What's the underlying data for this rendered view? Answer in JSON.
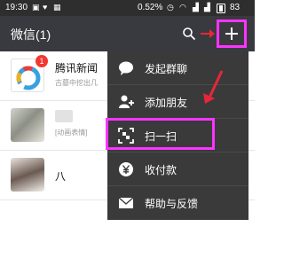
{
  "status_bar": {
    "time": "19:30",
    "battery_percent": "0.52%",
    "battery_level": "83"
  },
  "header": {
    "title": "微信(1)"
  },
  "chats": [
    {
      "name": "腾讯新闻",
      "preview": "古墓中挖出几",
      "badge": "1",
      "avatar": "news-logo"
    },
    {
      "name": "",
      "preview": "[动画表情]",
      "avatar": "photo"
    },
    {
      "name": "八",
      "preview": "",
      "avatar": "photo"
    }
  ],
  "menu": {
    "items": [
      {
        "label": "发起群聊",
        "icon": "chat-bubble-icon"
      },
      {
        "label": "添加朋友",
        "icon": "add-friend-icon"
      },
      {
        "label": "扫一扫",
        "icon": "scan-icon"
      },
      {
        "label": "收付款",
        "icon": "yen-icon"
      },
      {
        "label": "帮助与反馈",
        "icon": "mail-icon"
      }
    ]
  },
  "colors": {
    "header_bg": "#393a3f",
    "status_bg": "#2e2e2e",
    "menu_bg": "#3a3a3a",
    "highlight": "#ff33ff",
    "badge": "#f43530",
    "arrow": "#e8263a"
  }
}
